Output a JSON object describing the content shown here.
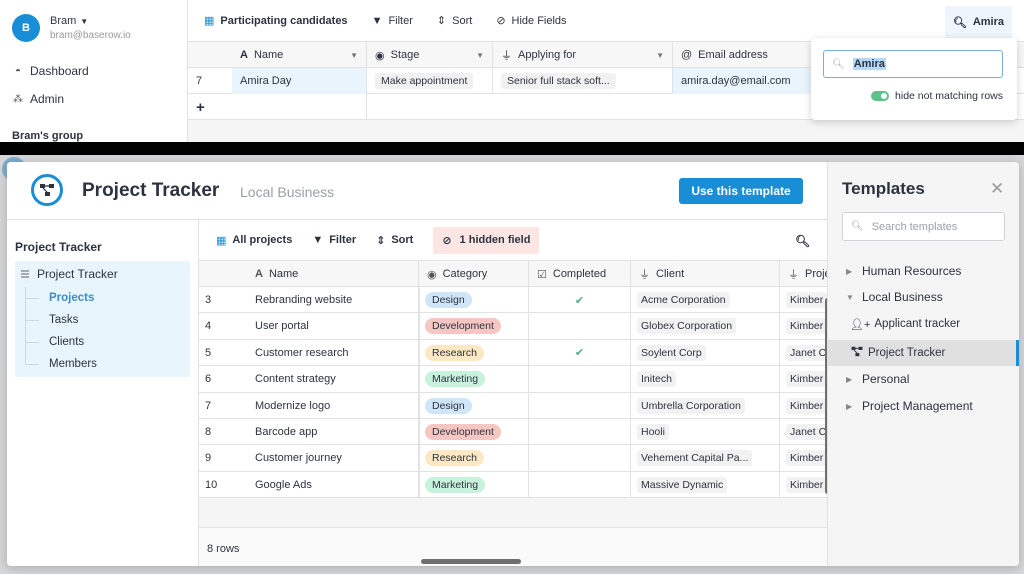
{
  "background_app": {
    "user": {
      "initial": "B",
      "name": "Bram",
      "email": "bram@baserow.io"
    },
    "sidebar": {
      "links": [
        {
          "label": "Dashboard",
          "icon": "tachometer-icon"
        },
        {
          "label": "Admin",
          "icon": "users-icon"
        }
      ],
      "group_title": "Bram's group"
    },
    "toolbar": {
      "view_name": "Participating candidates",
      "filter_label": "Filter",
      "sort_label": "Sort",
      "hide_fields_label": "Hide Fields",
      "search_label": "Amira"
    },
    "columns": [
      {
        "label": "Name",
        "icon": "text-icon"
      },
      {
        "label": "Stage",
        "icon": "single-select-icon"
      },
      {
        "label": "Applying for",
        "icon": "link-icon"
      },
      {
        "label": "Email address",
        "icon": "at-icon"
      }
    ],
    "rows": [
      {
        "id": "7",
        "name": "Amira Day",
        "stage": "Make appointment",
        "applying_for": "Senior full stack soft...",
        "email": "amira.day@email.com"
      }
    ],
    "search_popup": {
      "query": "Amira",
      "toggle_label": "hide not matching rows",
      "toggle_on": true
    }
  },
  "modal": {
    "title": "Project Tracker",
    "subtitle": "Local Business",
    "use_button": "Use this template",
    "nav": {
      "title": "Project Tracker",
      "database": "Project Tracker",
      "tables": [
        "Projects",
        "Tasks",
        "Clients",
        "Members"
      ],
      "active_table": "Projects"
    },
    "toolbar": {
      "view_name": "All projects",
      "filter_label": "Filter",
      "sort_label": "Sort",
      "hidden_label": "1 hidden field"
    },
    "columns": [
      {
        "label": "Name",
        "icon": "text-icon"
      },
      {
        "label": "Category",
        "icon": "single-select-icon"
      },
      {
        "label": "Completed",
        "icon": "checkbox-icon"
      },
      {
        "label": "Client",
        "icon": "link-icon"
      },
      {
        "label": "Proje",
        "icon": "link-icon"
      }
    ],
    "rows": [
      {
        "id": "3",
        "name": "Rebranding website",
        "category": "Design",
        "completed": true,
        "client": "Acme Corporation",
        "project": "Kimber"
      },
      {
        "id": "4",
        "name": "User portal",
        "category": "Development",
        "completed": false,
        "client": "Globex Corporation",
        "project": "Kimber"
      },
      {
        "id": "5",
        "name": "Customer research",
        "category": "Research",
        "completed": true,
        "client": "Soylent Corp",
        "project": "Janet C"
      },
      {
        "id": "6",
        "name": "Content strategy",
        "category": "Marketing",
        "completed": false,
        "client": "Initech",
        "project": "Kimber"
      },
      {
        "id": "7",
        "name": "Modernize logo",
        "category": "Design",
        "completed": false,
        "client": "Umbrella Corporation",
        "project": "Kimber"
      },
      {
        "id": "8",
        "name": "Barcode app",
        "category": "Development",
        "completed": false,
        "client": "Hooli",
        "project": "Janet C"
      },
      {
        "id": "9",
        "name": "Customer journey",
        "category": "Research",
        "completed": false,
        "client": "Vehement Capital Pa...",
        "project": "Kimber"
      },
      {
        "id": "10",
        "name": "Google Ads",
        "category": "Marketing",
        "completed": false,
        "client": "Massive Dynamic",
        "project": "Kimber"
      }
    ],
    "row_count": "8 rows",
    "category_colors": {
      "Design": {
        "bg": "#cfe5f8",
        "fg": "#2c3340"
      },
      "Development": {
        "bg": "#f6c6c2",
        "fg": "#2c3340"
      },
      "Research": {
        "bg": "#fde8c3",
        "fg": "#2c3340"
      },
      "Marketing": {
        "bg": "#c9f2dc",
        "fg": "#2c3340"
      }
    }
  },
  "templates_panel": {
    "title": "Templates",
    "search_placeholder": "Search templates",
    "categories": [
      {
        "label": "Human Resources",
        "expanded": false
      },
      {
        "label": "Local Business",
        "expanded": true,
        "items": [
          {
            "label": "Applicant tracker",
            "icon": "user-plus-icon",
            "active": false
          },
          {
            "label": "Project Tracker",
            "icon": "project-diagram-icon",
            "active": true
          }
        ]
      },
      {
        "label": "Personal",
        "expanded": false
      },
      {
        "label": "Project Management",
        "expanded": false
      }
    ]
  },
  "colors": {
    "accent": "#198dd6",
    "toggle_on": "#5cc28c",
    "hidden_field_bg": "#fbe6e4",
    "check": "#4caf7d"
  }
}
